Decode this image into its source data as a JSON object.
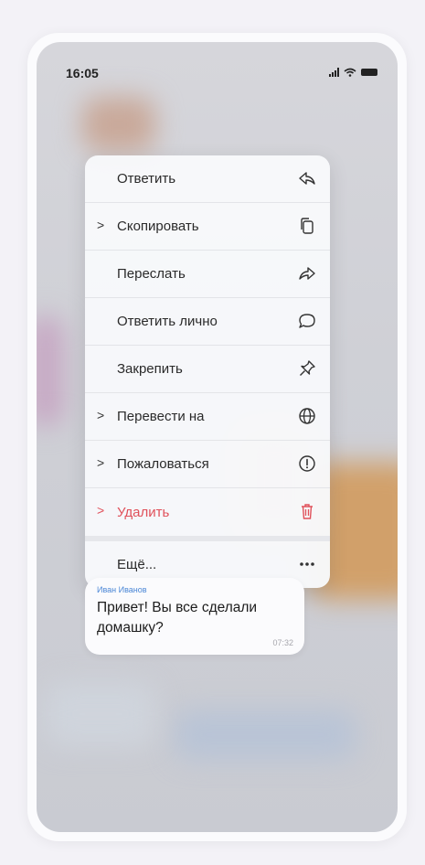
{
  "status_bar": {
    "time": "16:05"
  },
  "context_menu": {
    "items": [
      {
        "label": "Ответить",
        "chevron": "",
        "icon": "reply-icon"
      },
      {
        "label": "Скопировать",
        "chevron": ">",
        "icon": "copy-icon"
      },
      {
        "label": "Переслать",
        "chevron": "",
        "icon": "forward-icon"
      },
      {
        "label": "Ответить лично",
        "chevron": "",
        "icon": "private-reply-icon"
      },
      {
        "label": "Закрепить",
        "chevron": "",
        "icon": "pin-icon"
      },
      {
        "label": "Перевести на",
        "chevron": ">",
        "icon": "globe-icon"
      },
      {
        "label": "Пожаловаться",
        "chevron": ">",
        "icon": "report-icon"
      },
      {
        "label": "Удалить",
        "chevron": ">",
        "icon": "trash-icon",
        "color": "#e0505a"
      },
      {
        "label": "Ещё...",
        "chevron": "",
        "icon": "more-icon"
      }
    ]
  },
  "message": {
    "sender": "Иван Иванов",
    "text": "Привет! Вы все сделали домашку?",
    "time": "07:32"
  },
  "colors": {
    "accent": "#4a86d6",
    "danger": "#e0505a"
  }
}
